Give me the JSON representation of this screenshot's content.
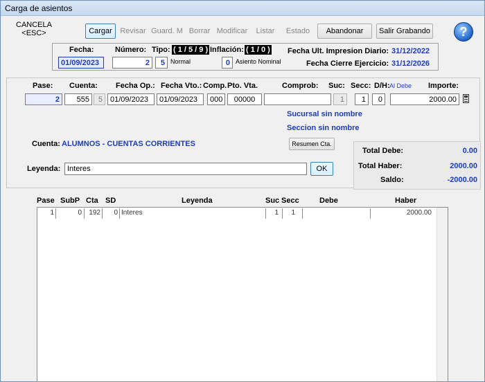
{
  "window": {
    "title": "Carga de asientos"
  },
  "toolbar": {
    "cancel": "CANCELA\n<ESC>",
    "cancel_line1": "CANCELA",
    "cancel_line2": "<ESC>",
    "buttons": [
      {
        "label": "Cargar",
        "enabled": true
      },
      {
        "label": "Revisar",
        "enabled": false
      },
      {
        "label": "Guard. M",
        "enabled": false
      },
      {
        "label": "Borrar",
        "enabled": false
      },
      {
        "label": "Modificar",
        "enabled": false
      },
      {
        "label": "Listar",
        "enabled": false
      },
      {
        "label": "Estado",
        "enabled": false
      },
      {
        "label": "Abandonar",
        "enabled": true
      },
      {
        "label": "Salir Grabando",
        "enabled": true
      }
    ],
    "help_icon": "help-icon"
  },
  "header": {
    "fecha_label": "Fecha:",
    "fecha_value": "01/09/2023",
    "numero_label": "Número:",
    "numero_value": "2",
    "tipo_label": "Tipo:",
    "tipo_badge": "( 1 / 5 / 9 )",
    "tipo_value": "5",
    "tipo_desc": "Normal",
    "inflacion_label": "Inflación:",
    "inflacion_badge": "( 1 / 0 )",
    "inflacion_value": "0",
    "inflacion_desc": "Asiento Nominal",
    "ult_impresion_label": "Fecha Ult. Impresion Diario:",
    "ult_impresion_value": "31/12/2022",
    "cierre_label": "Fecha Cierre Ejercicio:",
    "cierre_value": "31/12/2026"
  },
  "entry": {
    "labels": {
      "pase": "Pase:",
      "cuenta": "Cuenta:",
      "fecha_op": "Fecha Op.:",
      "fecha_vto": "Fecha Vto.:",
      "comp": "Comp.",
      "pto_vta": "Pto. Vta.",
      "comprob": "Comprob:",
      "suc": "Suc:",
      "secc": "Secc:",
      "dh": "D/H:",
      "dh_value": "Al Debe",
      "importe": "Importe:"
    },
    "values": {
      "pase": "2",
      "cuenta": "555",
      "subcuenta": "5",
      "fecha_op": "01/09/2023",
      "fecha_vto": "01/09/2023",
      "comp": "000",
      "pto_vta": "00000",
      "comprob": "",
      "suc": "1",
      "secc": "1",
      "dh": "0",
      "importe": "2000.00"
    },
    "sucursal_text": "Sucursal sin nombre",
    "seccion_text": "Seccion sin nombre",
    "cuenta_label": "Cuenta:",
    "cuenta_name": "ALUMNOS - CUENTAS CORRIENTES",
    "resumen_button": "Resumen Cta.",
    "leyenda_label": "Leyenda:",
    "leyenda_value": "Interes",
    "ok_button": "OK",
    "calc_icon": "calculator-icon"
  },
  "totals": {
    "debe_label": "Total Debe:",
    "debe_value": "0.00",
    "haber_label": "Total Haber:",
    "haber_value": "2000.00",
    "saldo_label": "Saldo:",
    "saldo_value": "-2000.00"
  },
  "grid": {
    "columns": [
      "Pase",
      "SubP",
      "Cta",
      "SD",
      "Leyenda",
      "Suc",
      "Secc",
      "Debe",
      "Haber"
    ],
    "rows": [
      {
        "pase": "1",
        "subp": "0",
        "cta": "192",
        "sd": "0",
        "leyenda": "Interes",
        "suc": "1",
        "secc": "1",
        "debe": "",
        "haber": "2000.00"
      }
    ]
  }
}
